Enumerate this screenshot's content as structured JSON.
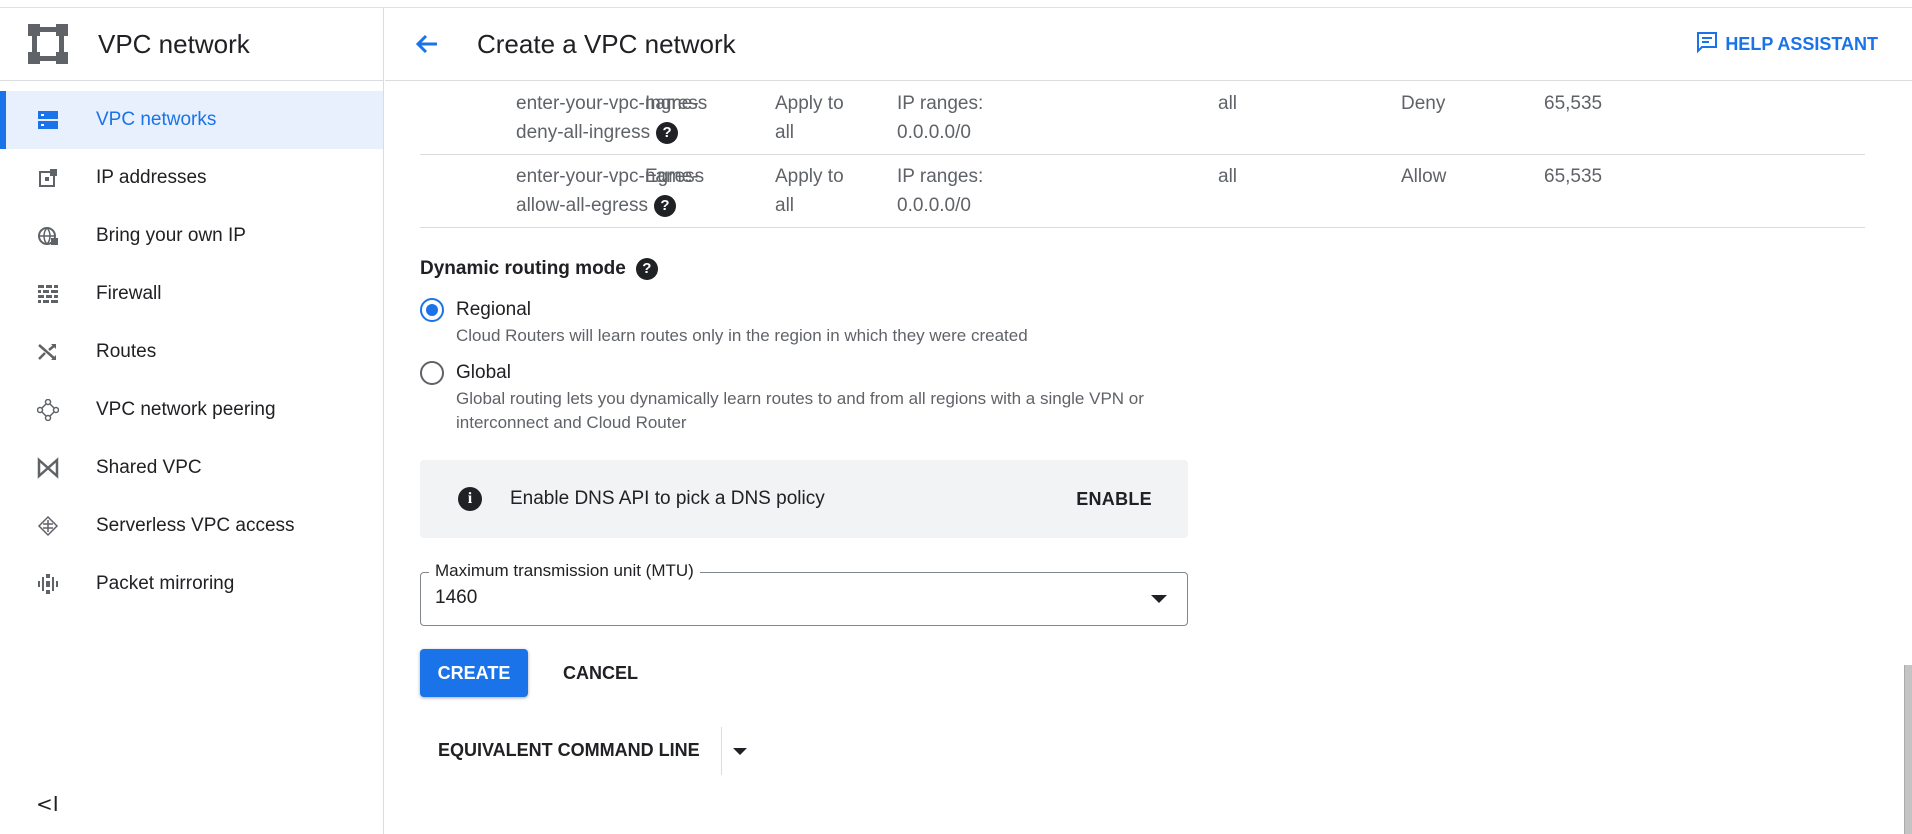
{
  "sidebar": {
    "title": "VPC network",
    "items": [
      {
        "label": "VPC networks",
        "icon": "vpc-networks-icon",
        "active": true
      },
      {
        "label": "IP addresses",
        "icon": "ip-addresses-icon"
      },
      {
        "label": "Bring your own IP",
        "icon": "globe-icon"
      },
      {
        "label": "Firewall",
        "icon": "firewall-icon"
      },
      {
        "label": "Routes",
        "icon": "routes-icon"
      },
      {
        "label": "VPC network peering",
        "icon": "peering-icon"
      },
      {
        "label": "Shared VPC",
        "icon": "shared-vpc-icon"
      },
      {
        "label": "Serverless VPC access",
        "icon": "serverless-icon"
      },
      {
        "label": "Packet mirroring",
        "icon": "packet-mirroring-icon"
      }
    ],
    "collapse_label": "<I"
  },
  "header": {
    "title": "Create a VPC network",
    "help": "HELP ASSISTANT"
  },
  "firewall_rows": [
    {
      "name_1": "enter-your-vpc-name-",
      "name_2": "deny-all-ingress",
      "direction": "Ingress",
      "apply_1": "Apply to",
      "apply_2": "all",
      "ip_1": "IP ranges:",
      "ip_2": "0.0.0.0/0",
      "protocols": "all",
      "action": "Deny",
      "priority": "65,535"
    },
    {
      "name_1": "enter-your-vpc-name-",
      "name_2": "allow-all-egress",
      "direction": "Egress",
      "apply_1": "Apply to",
      "apply_2": "all",
      "ip_1": "IP ranges:",
      "ip_2": "0.0.0.0/0",
      "protocols": "all",
      "action": "Allow",
      "priority": "65,535"
    }
  ],
  "routing": {
    "label": "Dynamic routing mode",
    "options": [
      {
        "label": "Regional",
        "desc": "Cloud Routers will learn routes only in the region in which they were created",
        "checked": true
      },
      {
        "label": "Global",
        "desc": "Global routing lets you dynamically learn routes to and from all regions with a single VPN or interconnect and Cloud Router",
        "checked": false
      }
    ]
  },
  "dns": {
    "text": "Enable DNS API to pick a DNS policy",
    "action": "ENABLE"
  },
  "mtu": {
    "label": "Maximum transmission unit (MTU)",
    "value": "1460"
  },
  "actions": {
    "create": "CREATE",
    "cancel": "CANCEL",
    "command_line": "EQUIVALENT COMMAND LINE"
  },
  "colors": {
    "accent": "#1a73e8",
    "active_bg": "#e8f0fe"
  }
}
